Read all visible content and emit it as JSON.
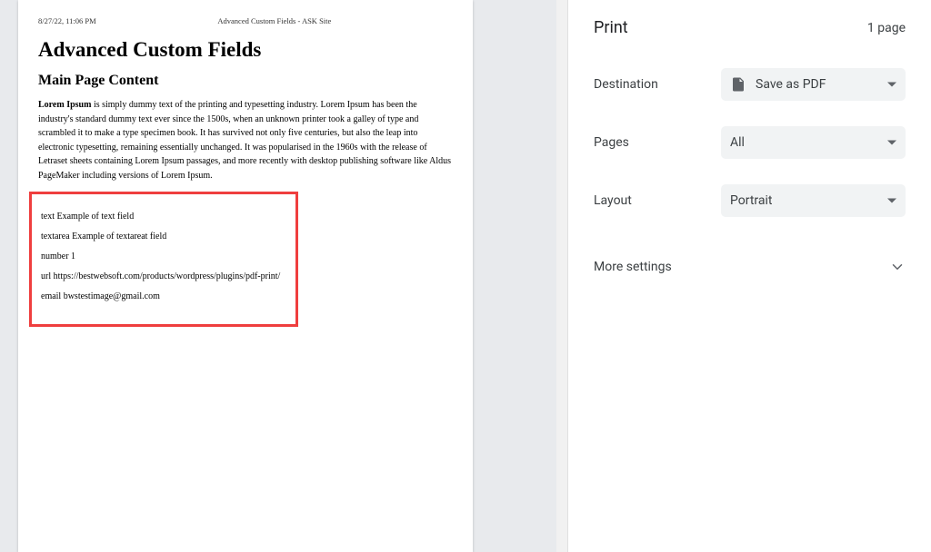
{
  "preview": {
    "timestamp": "8/27/22, 11:06 PM",
    "header_center": "Advanced Custom Fields - ASK Site",
    "doc_title": "Advanced Custom Fields",
    "doc_subtitle": "Main Page Content",
    "para_lead": "Lorem Ipsum",
    "para_rest": " is simply dummy text of the printing and typesetting industry. Lorem Ipsum has been the industry's standard dummy text ever since the 1500s, when an unknown printer took a galley of type and scrambled it to make a type specimen book. It has survived not only five centuries, but also the leap into electronic typesetting, remaining essentially unchanged. It was popularised in the 1960s with the release of Letraset sheets containing Lorem Ipsum passages, and more recently with desktop publishing software like Aldus PageMaker including versions of Lorem Ipsum.",
    "fields": [
      "text Example of text field",
      "textarea Example of textareat field",
      "number 1",
      "url https://bestwebsoft.com/products/wordpress/plugins/pdf-print/",
      "email bwstestimage@gmail.com"
    ]
  },
  "sidebar": {
    "title": "Print",
    "page_count": "1 page",
    "destination_label": "Destination",
    "destination_value": "Save as PDF",
    "pages_label": "Pages",
    "pages_value": "All",
    "layout_label": "Layout",
    "layout_value": "Portrait",
    "more_label": "More settings"
  }
}
